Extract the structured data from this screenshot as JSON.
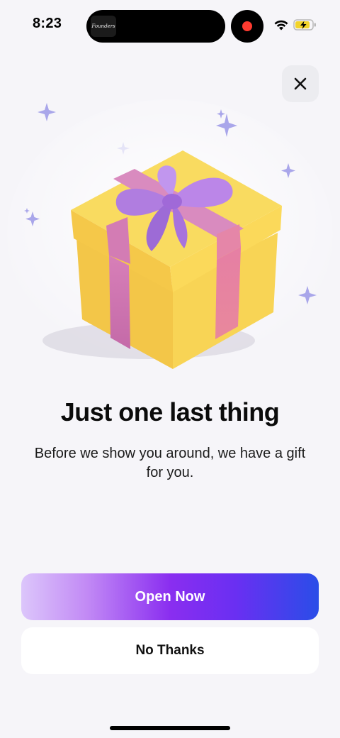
{
  "status_bar": {
    "time": "8:23",
    "island_app_label": "Founders",
    "wifi_icon": "wifi-icon",
    "battery_icon": "battery-charging-icon",
    "record_color": "#ff3b30"
  },
  "dialog": {
    "close_icon": "close-icon",
    "hero_image": "gift-box-illustration",
    "title": "Just one last thing",
    "subtitle": "Before we show you around, we have a gift for you.",
    "primary_button": "Open Now",
    "secondary_button": "No Thanks"
  },
  "colors": {
    "background": "#f6f5f9",
    "gift_yellow": "#f7cf4c",
    "ribbon_pink": "#e07aa8",
    "bow_purple": "#b27be3",
    "sparkle": "#a3a0e8",
    "button_gradient_start": "#dcc6fb",
    "button_gradient_mid": "#8a2ef0",
    "button_gradient_end": "#2a4de8"
  }
}
